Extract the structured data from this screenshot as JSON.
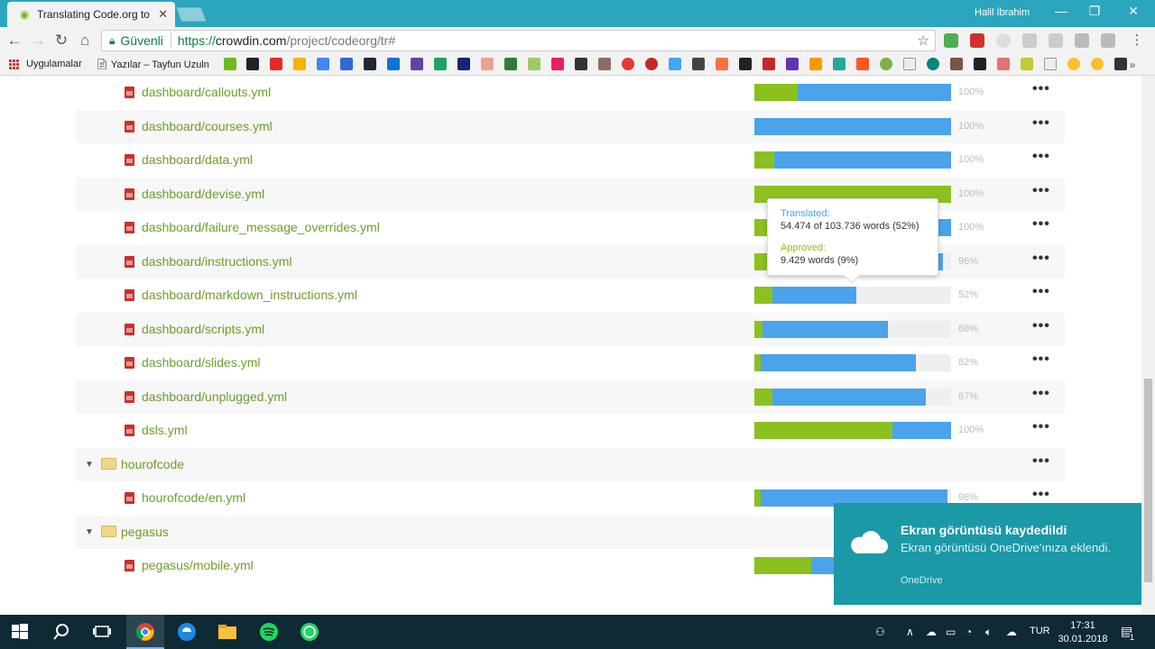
{
  "browser": {
    "tab_title": "Translating Code.org to T",
    "user_name": "Halil İbrahim",
    "secure_label": "Güvenli",
    "url_protocol": "https://",
    "url_host": "crowdin.com",
    "url_path": "/project/codeorg/tr#"
  },
  "bookmarks": {
    "apps_label": "Uygulamalar",
    "page_label": "Yazılar – Tayfun Uzuln"
  },
  "files": {
    "rows": [
      {
        "type": "file",
        "name": "dashboard/callouts.yml",
        "approved": 22,
        "translated": 100,
        "percent": "100%"
      },
      {
        "type": "file",
        "name": "dashboard/courses.yml",
        "approved": 0,
        "translated": 100,
        "percent": "100%"
      },
      {
        "type": "file",
        "name": "dashboard/data.yml",
        "approved": 10,
        "translated": 100,
        "percent": "100%"
      },
      {
        "type": "file",
        "name": "dashboard/devise.yml",
        "approved": 100,
        "translated": 100,
        "percent": "100%"
      },
      {
        "type": "file",
        "name": "dashboard/failure_message_overrides.yml",
        "approved": 20,
        "translated": 100,
        "percent": "100%"
      },
      {
        "type": "file",
        "name": "dashboard/instructions.yml",
        "approved": 15,
        "translated": 96,
        "percent": "96%"
      },
      {
        "type": "file",
        "name": "dashboard/markdown_instructions.yml",
        "approved": 9,
        "translated": 52,
        "percent": "52%"
      },
      {
        "type": "file",
        "name": "dashboard/scripts.yml",
        "approved": 4,
        "translated": 68,
        "percent": "68%"
      },
      {
        "type": "file",
        "name": "dashboard/slides.yml",
        "approved": 3,
        "translated": 82,
        "percent": "82%"
      },
      {
        "type": "file",
        "name": "dashboard/unplugged.yml",
        "approved": 9,
        "translated": 87,
        "percent": "87%"
      },
      {
        "type": "file",
        "name": "dsls.yml",
        "approved": 70,
        "translated": 100,
        "percent": "100%"
      },
      {
        "type": "folder",
        "name": "hourofcode"
      },
      {
        "type": "file",
        "name": "hourofcode/en.yml",
        "approved": 3,
        "translated": 98,
        "percent": "98%"
      },
      {
        "type": "folder",
        "name": "pegasus"
      },
      {
        "type": "file",
        "name": "pegasus/mobile.yml",
        "approved": 29,
        "translated": 100,
        "percent": ""
      }
    ]
  },
  "tooltip": {
    "translated_label": "Translated:",
    "translated_value": "54.474 of 103.736 words (52%)",
    "approved_label": "Approved:",
    "approved_value": "9.429 words (9%)"
  },
  "notification": {
    "title": "Ekran görüntüsü kaydedildi",
    "body": "Ekran görüntüsü OneDrive'ınıza eklendi.",
    "source": "OneDrive"
  },
  "taskbar": {
    "language": "TUR",
    "time": "17:31",
    "date": "30.01.2018",
    "notification_count": "1"
  },
  "colors": {
    "approved": "#8cc01f",
    "translated": "#4aa3eb",
    "link": "#6d9d2a",
    "titlebar": "#2ba6be",
    "toast": "#1b99a7"
  }
}
